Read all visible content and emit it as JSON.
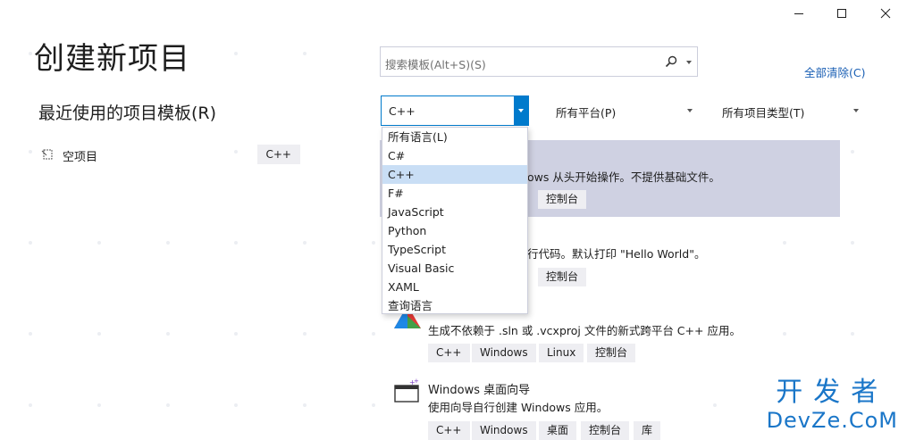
{
  "window": {
    "title": "创建新项目",
    "controls": [
      "minimize-icon",
      "maximize-icon",
      "close-icon"
    ]
  },
  "recent": {
    "heading": "最近使用的项目模板(R)",
    "items": [
      {
        "label": "空项目",
        "tag": "C++",
        "icon": "empty-project-icon"
      }
    ]
  },
  "search": {
    "placeholder": "搜索模板(Alt+S)(S)",
    "icon": "search-icon"
  },
  "clear_all": "全部清除(C)",
  "filters": {
    "language": "C++",
    "platform": "所有平台(P)",
    "project_type": "所有项目类型(T)"
  },
  "language_dropdown": {
    "options": [
      "所有语言(L)",
      "C#",
      "C++",
      "F#",
      "JavaScript",
      "Python",
      "TypeScript",
      "Visual Basic",
      "XAML",
      "查询语言"
    ],
    "selected": "C++"
  },
  "templates": [
    {
      "desc": "ows 从头开始操作。不提供基础文件。",
      "tags": [
        "控制台"
      ]
    },
    {
      "desc": "行代码。默认打印 \"Hello World\"。",
      "tags": [
        "控制台"
      ]
    },
    {
      "desc": "生成不依赖于 .sln 或 .vcxproj 文件的新式跨平台 C++ 应用。",
      "tags": [
        "C++",
        "Windows",
        "Linux",
        "控制台"
      ],
      "icon": "cmake-icon"
    },
    {
      "title": "Windows 桌面向导",
      "desc": "使用向导自行创建 Windows 应用。",
      "tags": [
        "C++",
        "Windows",
        "桌面",
        "控制台",
        "库"
      ],
      "icon": "desktop-wizard-icon"
    }
  ],
  "watermark": {
    "top": "开发者",
    "bottom": "DevZe.CoM"
  },
  "colors": {
    "accent": "#007acc",
    "selected_card": "#cfd1e2",
    "dropdown_selected": "#c9def5",
    "link": "#1a5fb4",
    "watermark": "#1a76c8"
  }
}
